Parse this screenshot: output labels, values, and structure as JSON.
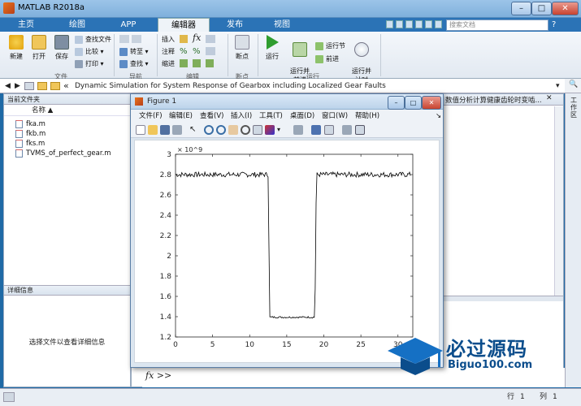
{
  "app": {
    "title": "MATLAB R2018a"
  },
  "tabs": [
    "主页",
    "绘图",
    "APP",
    "编辑器",
    "发布",
    "视图"
  ],
  "search": {
    "placeholder": "搜索文档"
  },
  "ribbon": {
    "file": {
      "new": "新建",
      "open": "打开",
      "save": "保存",
      "find_files": "查找文件",
      "compare": "比较",
      "print": "打印",
      "group": "文件"
    },
    "nav": {
      "goto": "转至",
      "find": "查找",
      "group": "导航"
    },
    "edit": {
      "insert": "插入",
      "comment": "注释",
      "indent": "缩进",
      "fx": "fx",
      "group": "编辑"
    },
    "breakpoints": {
      "label": "断点",
      "group": "断点"
    },
    "run": {
      "run": "运行",
      "run_advance": "运行并\n前进",
      "run_section": "运行节",
      "advance": "前进",
      "run_time": "运行并\n计时",
      "group": "运行"
    }
  },
  "address": {
    "path": "Dynamic Simulation for System Response of Gearbox including Localized Gear Faults",
    "prefix": "«"
  },
  "current_folder": {
    "title": "当前文件夹",
    "col_name": "名称 ▲",
    "files": [
      "fka.m",
      "fkb.m",
      "fks.m",
      "TVMS_of_perfect_gear.m"
    ]
  },
  "details": {
    "title": "详细信息",
    "placeholder": "选择文件以查看详细信息"
  },
  "editor_tab": {
    "label": "数值分析计算健康齿轮时变啮..."
  },
  "workspace_strip": {
    "label": "工作区"
  },
  "figure": {
    "title": "Figure 1",
    "menus": [
      "文件(F)",
      "编辑(E)",
      "查看(V)",
      "插入(I)",
      "工具(T)",
      "桌面(D)",
      "窗口(W)",
      "帮助(H)"
    ]
  },
  "chart_data": {
    "type": "line",
    "title": "",
    "xlabel": "",
    "ylabel": "",
    "y_exponent": "× 10^9",
    "xlim": [
      0,
      32
    ],
    "ylim": [
      1.2,
      3.0
    ],
    "xticks": [
      0,
      5,
      10,
      15,
      20,
      25,
      30
    ],
    "yticks": [
      1.2,
      1.4,
      1.6,
      1.8,
      2.0,
      2.2,
      2.4,
      2.6,
      2.8,
      3.0
    ],
    "yticklabels": [
      "1.2",
      "1.4",
      "1.6",
      "1.8",
      "2",
      "2.2",
      "2.4",
      "2.6",
      "2.8",
      "3"
    ],
    "grid": false,
    "series": [
      {
        "color": "#000000",
        "high_level": 2.8,
        "low_level": 1.395,
        "fluctuation": 0.025,
        "drop_x": [
          12.5,
          12.7
        ],
        "rise_x": [
          18.8,
          19.0
        ],
        "x_end": 31.8
      }
    ]
  },
  "command": {
    "prompt": "fx >>"
  },
  "status": {
    "row_label": "行",
    "row": "1",
    "col_label": "列",
    "col": "1"
  },
  "watermark": {
    "line1": "必过源码",
    "line2": "Biguo100.com"
  }
}
